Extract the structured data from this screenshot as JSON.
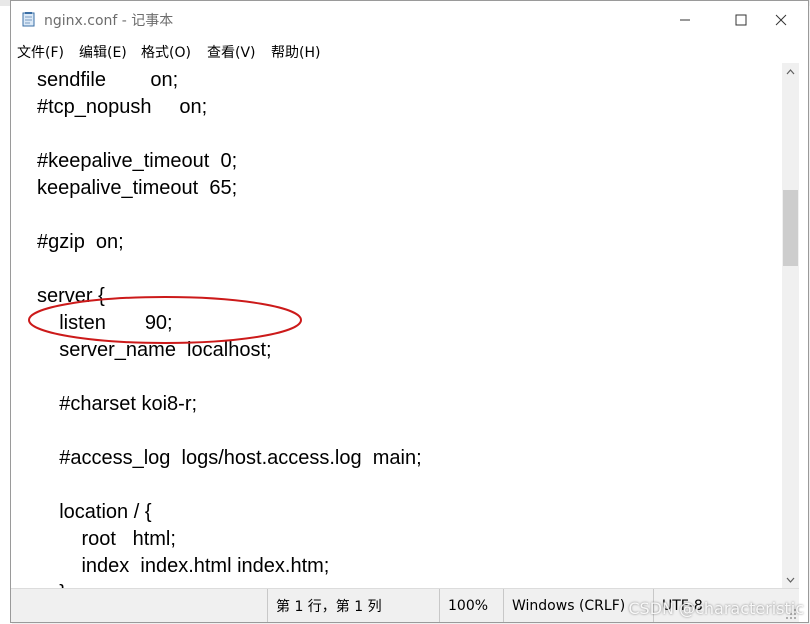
{
  "window": {
    "title": "nginx.conf - 记事本",
    "minimize_icon": "minimize-icon",
    "maximize_icon": "maximize-icon",
    "close_icon": "close-icon"
  },
  "menu": {
    "items": [
      {
        "label": "文件(F)"
      },
      {
        "label": "编辑(E)"
      },
      {
        "label": "格式(O)"
      },
      {
        "label": "查看(V)"
      },
      {
        "label": "帮助(H)"
      }
    ]
  },
  "editor": {
    "content": "sendfile        on;\n#tcp_nopush     on;\n\n#keepalive_timeout  0;\nkeepalive_timeout  65;\n\n#gzip  on;\n\nserver {\n    listen       90;\n    server_name  localhost;\n\n    #charset koi8-r;\n\n    #access_log  logs/host.access.log  main;\n\n    location / {\n        root   html;\n        index  index.html index.htm;\n    }"
  },
  "annotation": {
    "shape": "ellipse",
    "color": "#cc1a1a",
    "highlights": "listen       90;"
  },
  "status": {
    "position": "第 1 行，第 1 列",
    "zoom": "100%",
    "line_ending": "Windows (CRLF)",
    "encoding": "UTF-8"
  },
  "watermark": {
    "text": "CSDN @characteristic"
  }
}
